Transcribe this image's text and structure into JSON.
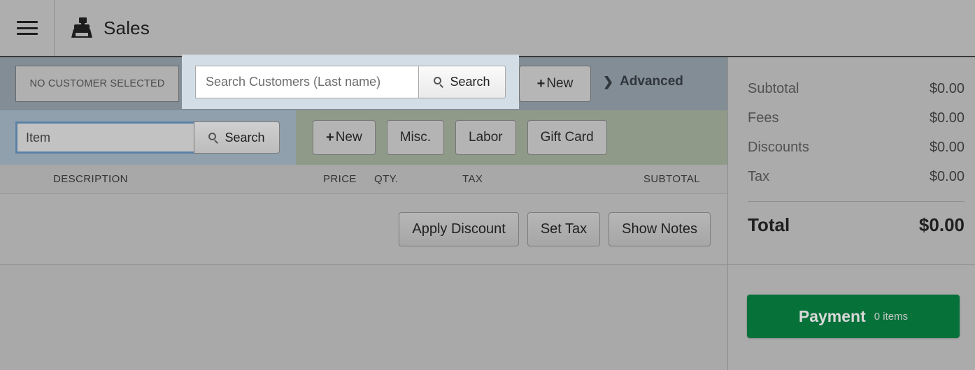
{
  "header": {
    "menu_icon": "hamburger-icon",
    "app_icon": "cash-register-icon",
    "title": "Sales"
  },
  "customer_bar": {
    "no_customer_label": "NO CUSTOMER SELECTED",
    "search": {
      "placeholder": "Search Customers (Last name)",
      "value": "",
      "button_label": "Search",
      "button_icon": "search-icon"
    },
    "new_button": {
      "plus": "+",
      "label": "New"
    },
    "advanced": {
      "chevron": "❯",
      "label": "Advanced"
    }
  },
  "item_bar": {
    "search": {
      "placeholder": "Item",
      "value": "",
      "button_label": "Search",
      "button_icon": "search-icon"
    },
    "buttons": [
      {
        "plus": "+",
        "label": "New"
      },
      {
        "plus": "",
        "label": "Misc."
      },
      {
        "plus": "",
        "label": "Labor"
      },
      {
        "plus": "",
        "label": "Gift Card"
      }
    ]
  },
  "line_items_table": {
    "columns": {
      "description": "DESCRIPTION",
      "price": "PRICE",
      "qty": "QTY.",
      "tax": "TAX",
      "subtotal": "SUBTOTAL"
    },
    "rows": []
  },
  "order_actions": [
    {
      "label": "Apply Discount"
    },
    {
      "label": "Set Tax"
    },
    {
      "label": "Show Notes"
    }
  ],
  "summary": {
    "rows": [
      {
        "label": "Subtotal",
        "value": "$0.00"
      },
      {
        "label": "Fees",
        "value": "$0.00"
      },
      {
        "label": "Discounts",
        "value": "$0.00"
      },
      {
        "label": "Tax",
        "value": "$0.00"
      }
    ],
    "total": {
      "label": "Total",
      "value": "$0.00"
    }
  },
  "payment": {
    "label": "Payment",
    "count": "0 items",
    "color": "#07713a"
  },
  "colors": {
    "header_bg": "#aeaeae",
    "customer_bar_bg": "#828d96",
    "spotlight_bg": "#d3dde5",
    "item_bar_bg": "#90a0ad",
    "item_actions_bg": "#8f9a89",
    "content_bg": "#ababab",
    "payment_green": "#07713a",
    "focus_blue": "#5b82a6"
  }
}
